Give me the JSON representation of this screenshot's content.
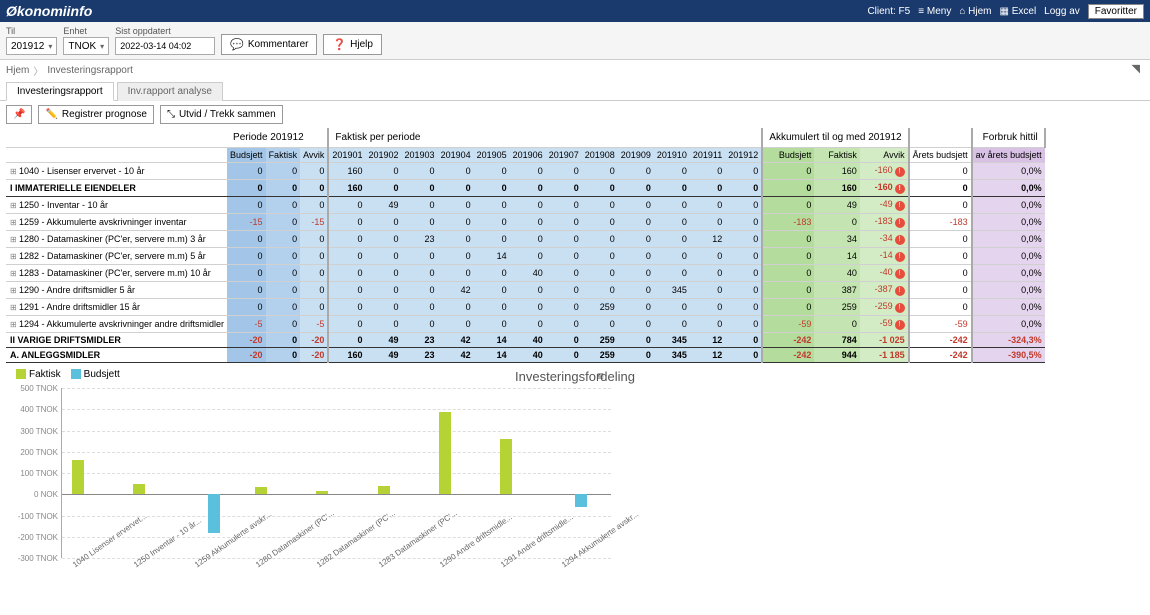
{
  "topbar": {
    "brand": "Økonomiinfo",
    "links": [
      "Client: F5",
      "Meny",
      "Hjem",
      "Excel",
      "Logg av"
    ],
    "icons": [
      "list-icon",
      "home-icon",
      "grid-icon",
      ""
    ],
    "favorites": "Favoritter"
  },
  "filters": {
    "til_label": "Til",
    "til_value": "201912",
    "enhet_label": "Enhet",
    "enhet_value": "TNOK",
    "sist_label": "Sist oppdatert",
    "sist_value": "2022-03-14 04:02",
    "kommentarer": "Kommentarer",
    "hjelp": "Hjelp"
  },
  "breadcrumbs": [
    "Hjem",
    "Investeringsrapport"
  ],
  "tabs": [
    {
      "label": "Investeringsrapport",
      "active": true
    },
    {
      "label": "Inv.rapport analyse",
      "active": false
    }
  ],
  "toolbar": {
    "pin": "",
    "registrer": "Registrer prognose",
    "utvid": "Utvid / Trekk sammen"
  },
  "table": {
    "group_headers": [
      "Periode 201912",
      "Faktisk per periode",
      "Akkumulert til og med 201912",
      "",
      "Forbruk hittil"
    ],
    "cols": {
      "p": [
        "Budsjett",
        "Faktisk",
        "Avvik"
      ],
      "months": [
        "201901",
        "201902",
        "201903",
        "201904",
        "201905",
        "201906",
        "201907",
        "201908",
        "201909",
        "201910",
        "201911",
        "201912"
      ],
      "akk": [
        "Budsjett",
        "Faktisk",
        "Avvik"
      ],
      "year": "Årets budsjett",
      "pct": "av årets budsjett"
    },
    "rows": [
      {
        "label": "1040 - Lisenser ervervet - 10 år",
        "exp": true,
        "p": [
          0,
          0,
          0
        ],
        "m": [
          160,
          0,
          0,
          0,
          0,
          0,
          0,
          0,
          0,
          0,
          0,
          0
        ],
        "a": [
          0,
          160,
          -160
        ],
        "dot": true,
        "y": 0,
        "pc": "0,0%",
        "bold": false
      },
      {
        "label": "I IMMATERIELLE EIENDELER",
        "exp": false,
        "p": [
          0,
          0,
          0
        ],
        "m": [
          160,
          0,
          0,
          0,
          0,
          0,
          0,
          0,
          0,
          0,
          0,
          0
        ],
        "a": [
          0,
          160,
          -160
        ],
        "dot": true,
        "y": 0,
        "pc": "0,0%",
        "bold": true
      },
      {
        "label": "1250 - Inventar - 10 år",
        "exp": true,
        "p": [
          0,
          0,
          0
        ],
        "m": [
          0,
          49,
          0,
          0,
          0,
          0,
          0,
          0,
          0,
          0,
          0,
          0
        ],
        "a": [
          0,
          49,
          -49
        ],
        "dot": true,
        "y": 0,
        "pc": "0,0%",
        "bold": false
      },
      {
        "label": "1259 - Akkumulerte avskrivninger inventar",
        "exp": true,
        "p": [
          -15,
          0,
          -15
        ],
        "m": [
          0,
          0,
          0,
          0,
          0,
          0,
          0,
          0,
          0,
          0,
          0,
          0
        ],
        "a": [
          -183,
          0,
          -183
        ],
        "dot": true,
        "y": -183,
        "pc": "0,0%",
        "bold": false
      },
      {
        "label": "1280 - Datamaskiner (PC'er, servere m.m) 3 år",
        "exp": true,
        "p": [
          0,
          0,
          0
        ],
        "m": [
          0,
          0,
          23,
          0,
          0,
          0,
          0,
          0,
          0,
          0,
          12,
          0
        ],
        "a": [
          0,
          34,
          -34
        ],
        "dot": true,
        "y": 0,
        "pc": "0,0%",
        "bold": false
      },
      {
        "label": "1282 - Datamaskiner (PC'er, servere m.m) 5 år",
        "exp": true,
        "p": [
          0,
          0,
          0
        ],
        "m": [
          0,
          0,
          0,
          0,
          14,
          0,
          0,
          0,
          0,
          0,
          0,
          0
        ],
        "a": [
          0,
          14,
          -14
        ],
        "dot": true,
        "y": 0,
        "pc": "0,0%",
        "bold": false
      },
      {
        "label": "1283 - Datamaskiner (PC'er, servere m.m) 10 år",
        "exp": true,
        "p": [
          0,
          0,
          0
        ],
        "m": [
          0,
          0,
          0,
          0,
          0,
          40,
          0,
          0,
          0,
          0,
          0,
          0
        ],
        "a": [
          0,
          40,
          -40
        ],
        "dot": true,
        "y": 0,
        "pc": "0,0%",
        "bold": false
      },
      {
        "label": "1290 - Andre driftsmidler 5 år",
        "exp": true,
        "p": [
          0,
          0,
          0
        ],
        "m": [
          0,
          0,
          0,
          42,
          0,
          0,
          0,
          0,
          0,
          345,
          0,
          0
        ],
        "a": [
          0,
          387,
          -387
        ],
        "dot": true,
        "y": 0,
        "pc": "0,0%",
        "bold": false
      },
      {
        "label": "1291 - Andre driftsmidler 15 år",
        "exp": true,
        "p": [
          0,
          0,
          0
        ],
        "m": [
          0,
          0,
          0,
          0,
          0,
          0,
          0,
          259,
          0,
          0,
          0,
          0
        ],
        "a": [
          0,
          259,
          -259
        ],
        "dot": true,
        "y": 0,
        "pc": "0,0%",
        "bold": false
      },
      {
        "label": "1294 - Akkumulerte avskrivninger andre driftsmidler",
        "exp": true,
        "p": [
          -5,
          0,
          -5
        ],
        "m": [
          0,
          0,
          0,
          0,
          0,
          0,
          0,
          0,
          0,
          0,
          0,
          0
        ],
        "a": [
          -59,
          0,
          -59
        ],
        "dot": true,
        "y": -59,
        "pc": "0,0%",
        "bold": false
      },
      {
        "label": "II VARIGE DRIFTSMIDLER",
        "exp": false,
        "p": [
          -20,
          0,
          -20
        ],
        "m": [
          0,
          49,
          23,
          42,
          14,
          40,
          0,
          259,
          0,
          345,
          12,
          0
        ],
        "a": [
          -242,
          784,
          "-1 025"
        ],
        "dot": false,
        "y": -242,
        "pc": "-324,3%",
        "bold": true
      },
      {
        "label": "A. ANLEGGSMIDLER",
        "exp": false,
        "p": [
          -20,
          0,
          -20
        ],
        "m": [
          160,
          49,
          23,
          42,
          14,
          40,
          0,
          259,
          0,
          345,
          12,
          0
        ],
        "a": [
          -242,
          944,
          "-1 185"
        ],
        "dot": false,
        "y": -242,
        "pc": "-390,5%",
        "bold": true
      }
    ]
  },
  "chart_data": {
    "type": "bar",
    "title": "Investeringsfordeling",
    "legend": [
      "Faktisk",
      "Budsjett"
    ],
    "ylabel": "TNOK",
    "ylim": [
      -300,
      500
    ],
    "yticks": [
      -300,
      -200,
      -100,
      0,
      100,
      200,
      300,
      400,
      500
    ],
    "ytick_labels": [
      "-300 TNOK",
      "-200 TNOK",
      "-100 TNOK",
      "0 NOK",
      "100 TNOK",
      "200 TNOK",
      "300 TNOK",
      "400 TNOK",
      "500 TNOK"
    ],
    "categories": [
      "1040 Lisenser ervervet...",
      "1250 Inventar - 10 år...",
      "1259 Akkumulerte avskr...",
      "1280 Datamaskiner (PC'...",
      "1282 Datamaskiner (PC'...",
      "1283 Datamaskiner (PC'...",
      "1290 Andre driftsmidle...",
      "1291 Andre driftsmidle...",
      "1294 Akkumulerte avskr..."
    ],
    "series": [
      {
        "name": "Faktisk",
        "values": [
          160,
          49,
          0,
          34,
          14,
          40,
          387,
          259,
          0
        ]
      },
      {
        "name": "Budsjett",
        "values": [
          0,
          0,
          -183,
          0,
          0,
          0,
          0,
          0,
          -59
        ]
      }
    ]
  }
}
